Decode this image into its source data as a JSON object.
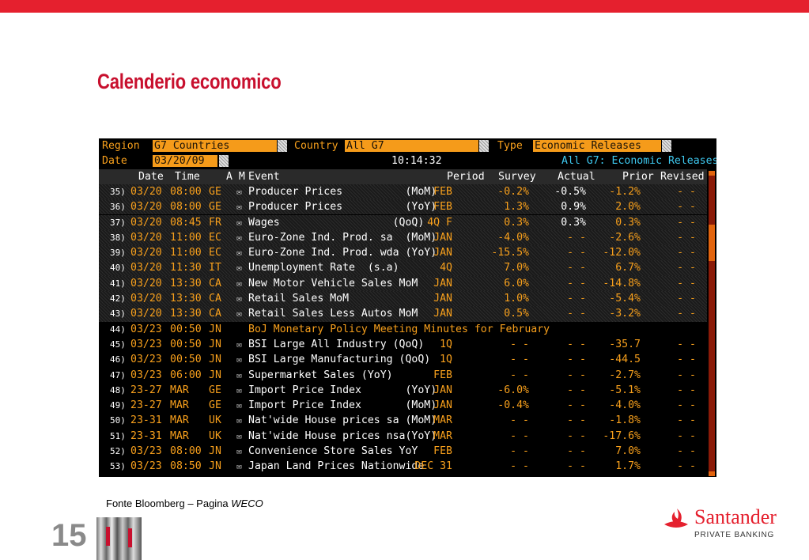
{
  "slide": {
    "title": "Calenderio economico",
    "source_prefix": "Fonte Bloomberg – Pagina ",
    "source_page": "WECO",
    "page_number": "15"
  },
  "brand": {
    "name": "Santander",
    "sub": "PRIVATE BANKING",
    "color": "#e5202e"
  },
  "terminal": {
    "region_label": "Region",
    "region_value": "G7 Countries",
    "country_label": "Country",
    "country_value": "All G7",
    "type_label": "Type",
    "type_value": "Economic Releases",
    "date_label": "Date",
    "date_value": "03/20/09",
    "clock": "10:14:32",
    "view_title": "All G7: Economic Releases",
    "columns": {
      "date": "Date",
      "time": "Time",
      "am": "A M",
      "event": "Event",
      "period": "Period",
      "survey": "Survey",
      "actual": "Actual",
      "prior": "Prior",
      "revised": "Revised"
    },
    "rows": [
      {
        "num": "35)",
        "date": "03/20",
        "time": "08:00",
        "cc": "GE",
        "event": "Producer Prices          (MoM)",
        "period": "FEB",
        "survey": "-0.2%",
        "actual": "-0.5%",
        "prior": "-1.2%",
        "revised": "- -",
        "actual_white": true,
        "shaded": true,
        "icon": true
      },
      {
        "num": "36)",
        "date": "03/20",
        "time": "08:00",
        "cc": "GE",
        "event": "Producer Prices          (YoY)",
        "period": "FEB",
        "survey": "1.3%",
        "actual": "0.9%",
        "prior": "2.0%",
        "revised": "- -",
        "actual_white": true,
        "shaded": true,
        "icon": true
      },
      {
        "num": "37)",
        "date": "03/20",
        "time": "08:45",
        "cc": "FR",
        "event": "Wages                  (QoQ)",
        "period": "4Q F",
        "survey": "0.3%",
        "actual": "0.3%",
        "prior": "0.3%",
        "revised": "- -",
        "actual_white": true,
        "shaded": true,
        "icon": true
      },
      {
        "num": "38)",
        "date": "03/20",
        "time": "11:00",
        "cc": "EC",
        "event": "Euro-Zone Ind. Prod. sa  (MoM)",
        "period": "JAN",
        "survey": "-4.0%",
        "actual": "- -",
        "prior": "-2.6%",
        "revised": "- -",
        "shaded": true,
        "icon": true
      },
      {
        "num": "39)",
        "date": "03/20",
        "time": "11:00",
        "cc": "EC",
        "event": "Euro-Zone Ind. Prod. wda (YoY)",
        "period": "JAN",
        "survey": "-15.5%",
        "actual": "- -",
        "prior": "-12.0%",
        "revised": "- -",
        "shaded": true,
        "icon": true
      },
      {
        "num": "40)",
        "date": "03/20",
        "time": "11:30",
        "cc": "IT",
        "event": "Unemployment Rate  (s.a)",
        "period": "4Q",
        "survey": "7.0%",
        "actual": "- -",
        "prior": "6.7%",
        "revised": "- -",
        "shaded": true,
        "icon": true
      },
      {
        "num": "41)",
        "date": "03/20",
        "time": "13:30",
        "cc": "CA",
        "event": "New Motor Vehicle Sales MoM",
        "period": "JAN",
        "survey": "6.0%",
        "actual": "- -",
        "prior": "-14.8%",
        "revised": "- -",
        "shaded": true,
        "icon": true
      },
      {
        "num": "42)",
        "date": "03/20",
        "time": "13:30",
        "cc": "CA",
        "event": "Retail Sales MoM",
        "period": "JAN",
        "survey": "1.0%",
        "actual": "- -",
        "prior": "-5.4%",
        "revised": "- -",
        "shaded": true,
        "icon": true
      },
      {
        "num": "43)",
        "date": "03/20",
        "time": "13:30",
        "cc": "CA",
        "event": "Retail Sales Less Autos MoM",
        "period": "JAN",
        "survey": "0.5%",
        "actual": "- -",
        "prior": "-3.2%",
        "revised": "- -",
        "shaded": true,
        "icon": true
      },
      {
        "num": "44)",
        "date": "03/23",
        "time": "00:50",
        "cc": "JN",
        "event": "BoJ Monetary Policy Meeting Minutes for February",
        "period": "",
        "survey": "",
        "actual": "",
        "prior": "",
        "revised": "",
        "icon": false
      },
      {
        "num": "45)",
        "date": "03/23",
        "time": "00:50",
        "cc": "JN",
        "event": "BSI Large All Industry (QoQ)",
        "period": "1Q",
        "survey": "- -",
        "actual": "- -",
        "prior": "-35.7",
        "revised": "- -",
        "icon": true
      },
      {
        "num": "46)",
        "date": "03/23",
        "time": "00:50",
        "cc": "JN",
        "event": "BSI Large Manufacturing (QoQ)",
        "period": "1Q",
        "survey": "- -",
        "actual": "- -",
        "prior": "-44.5",
        "revised": "- -",
        "icon": true
      },
      {
        "num": "47)",
        "date": "03/23",
        "time": "06:00",
        "cc": "JN",
        "event": "Supermarket Sales (YoY)",
        "period": "FEB",
        "survey": "- -",
        "actual": "- -",
        "prior": "-2.7%",
        "revised": "- -",
        "icon": true
      },
      {
        "num": "48)",
        "date": "23-27",
        "time": "MAR",
        "cc": "GE",
        "event": "Import Price Index       (YoY)",
        "period": "JAN",
        "survey": "-6.0%",
        "actual": "- -",
        "prior": "-5.1%",
        "revised": "- -",
        "icon": true
      },
      {
        "num": "49)",
        "date": "23-27",
        "time": "MAR",
        "cc": "GE",
        "event": "Import Price Index       (MoM)",
        "period": "JAN",
        "survey": "-0.4%",
        "actual": "- -",
        "prior": "-4.0%",
        "revised": "- -",
        "icon": true
      },
      {
        "num": "50)",
        "date": "23-31",
        "time": "MAR",
        "cc": "UK",
        "event": "Nat'wide House prices sa (MoM)",
        "period": "MAR",
        "survey": "- -",
        "actual": "- -",
        "prior": "-1.8%",
        "revised": "- -",
        "icon": true
      },
      {
        "num": "51)",
        "date": "23-31",
        "time": "MAR",
        "cc": "UK",
        "event": "Nat'wide House prices nsa(YoY)",
        "period": "MAR",
        "survey": "- -",
        "actual": "- -",
        "prior": "-17.6%",
        "revised": "- -",
        "icon": true
      },
      {
        "num": "52)",
        "date": "03/23",
        "time": "08:00",
        "cc": "JN",
        "event": "Convenience Store Sales YoY",
        "period": "FEB",
        "survey": "- -",
        "actual": "- -",
        "prior": "7.0%",
        "revised": "- -",
        "icon": true
      },
      {
        "num": "53)",
        "date": "03/23",
        "time": "08:50",
        "cc": "JN",
        "event": "Japan Land Prices Nationwide",
        "period": "DEC 31",
        "survey": "- -",
        "actual": "- -",
        "prior": "1.7%",
        "revised": "- -",
        "icon": true
      }
    ]
  }
}
